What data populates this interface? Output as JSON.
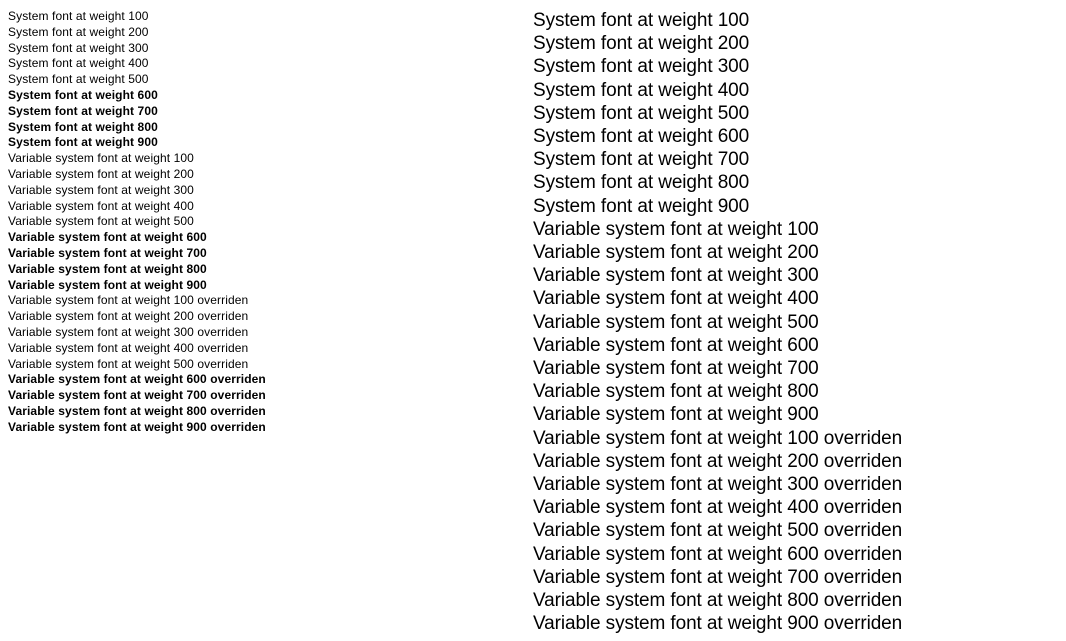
{
  "left": {
    "items": [
      {
        "text": "System font at weight 100",
        "weight": 100
      },
      {
        "text": "System font at weight 200",
        "weight": 200
      },
      {
        "text": "System font at weight 300",
        "weight": 300
      },
      {
        "text": "System font at weight 400",
        "weight": 400
      },
      {
        "text": "System font at weight 500",
        "weight": 500
      },
      {
        "text": "System font at weight 600",
        "weight": 600
      },
      {
        "text": "System font at weight 700",
        "weight": 700
      },
      {
        "text": "System font at weight 800",
        "weight": 800
      },
      {
        "text": "System font at weight 900",
        "weight": 900
      },
      {
        "text": "Variable system font at weight 100",
        "weight": 100
      },
      {
        "text": "Variable system font at weight 200",
        "weight": 200
      },
      {
        "text": "Variable system font at weight 300",
        "weight": 300
      },
      {
        "text": "Variable system font at weight 400",
        "weight": 400
      },
      {
        "text": "Variable system font at weight 500",
        "weight": 500
      },
      {
        "text": "Variable system font at weight 600",
        "weight": 600
      },
      {
        "text": "Variable system font at weight 700",
        "weight": 700
      },
      {
        "text": "Variable system font at weight 800",
        "weight": 800
      },
      {
        "text": "Variable system font at weight 900",
        "weight": 900
      },
      {
        "text": "Variable system font at weight 100 overriden",
        "weight": 100
      },
      {
        "text": "Variable system font at weight 200 overriden",
        "weight": 200
      },
      {
        "text": "Variable system font at weight 300 overriden",
        "weight": 300
      },
      {
        "text": "Variable system font at weight 400 overriden",
        "weight": 400
      },
      {
        "text": "Variable system font at weight 500 overriden",
        "weight": 500
      },
      {
        "text": "Variable system font at weight 600 overriden",
        "weight": 600
      },
      {
        "text": "Variable system font at weight 700 overriden",
        "weight": 700
      },
      {
        "text": "Variable system font at weight 800 overriden",
        "weight": 800
      },
      {
        "text": "Variable system font at weight 900 overriden",
        "weight": 900
      }
    ]
  },
  "right": {
    "items": [
      {
        "text": "System font at weight 100"
      },
      {
        "text": "System font at weight 200"
      },
      {
        "text": "System font at weight 300"
      },
      {
        "text": "System font at weight 400"
      },
      {
        "text": "System font at weight 500"
      },
      {
        "text": "System font at weight 600"
      },
      {
        "text": "System font at weight 700"
      },
      {
        "text": "System font at weight 800"
      },
      {
        "text": "System font at weight 900"
      },
      {
        "text": "Variable system font at weight 100"
      },
      {
        "text": "Variable system font at weight 200"
      },
      {
        "text": "Variable system font at weight 300"
      },
      {
        "text": "Variable system font at weight 400"
      },
      {
        "text": "Variable system font at weight 500"
      },
      {
        "text": "Variable system font at weight 600"
      },
      {
        "text": "Variable system font at weight 700"
      },
      {
        "text": "Variable system font at weight 800"
      },
      {
        "text": "Variable system font at weight 900"
      },
      {
        "text": "Variable system font at weight 100 overriden"
      },
      {
        "text": "Variable system font at weight 200 overriden"
      },
      {
        "text": "Variable system font at weight 300 overriden"
      },
      {
        "text": "Variable system font at weight 400 overriden"
      },
      {
        "text": "Variable system font at weight 500 overriden"
      },
      {
        "text": "Variable system font at weight 600 overriden"
      },
      {
        "text": "Variable system font at weight 700 overriden"
      },
      {
        "text": "Variable system font at weight 800 overriden"
      },
      {
        "text": "Variable system font at weight 900 overriden"
      }
    ]
  }
}
